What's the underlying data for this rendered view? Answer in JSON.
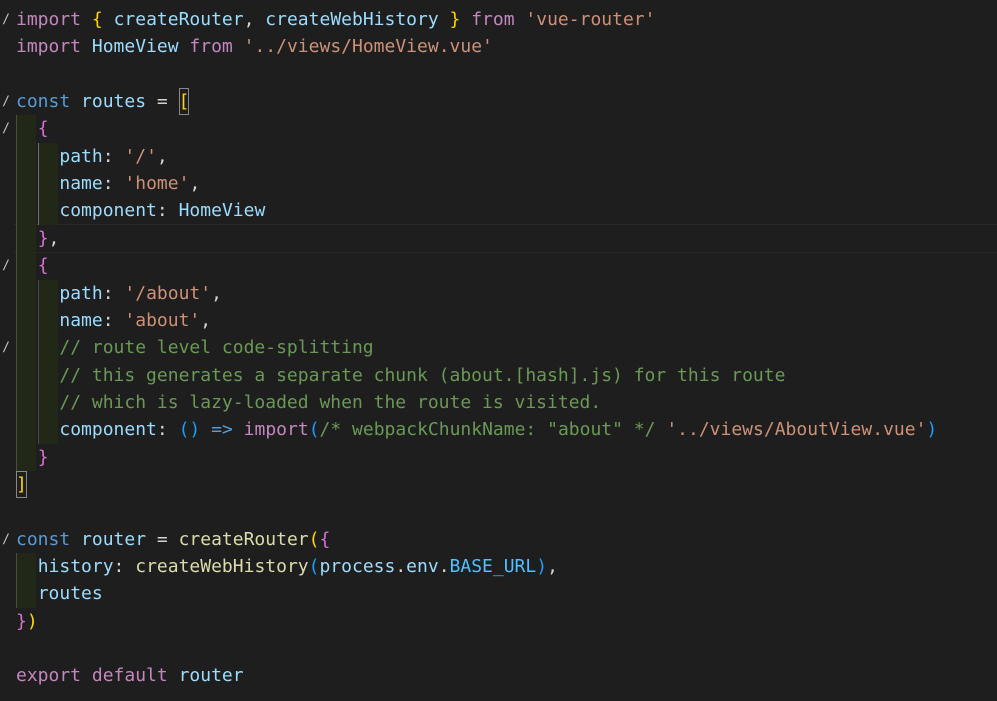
{
  "editor": {
    "language": "javascript",
    "colors": {
      "background": "#1e1e1e",
      "keyword": "#c586c0",
      "declaration": "#569cd6",
      "variable": "#9cdcfe",
      "constant": "#4fc1ff",
      "function": "#dcdcaa",
      "string": "#ce9178",
      "comment": "#6a9955",
      "bracket_level_1": "#ffd700",
      "bracket_level_2": "#da70d6",
      "bracket_level_3": "#179fff"
    },
    "lines": [
      [
        [
          "import",
          "kw"
        ],
        [
          " ",
          "pl"
        ],
        [
          "{",
          "b1"
        ],
        [
          " ",
          "pl"
        ],
        [
          "createRouter",
          "var"
        ],
        [
          ", ",
          "pl"
        ],
        [
          "createWebHistory",
          "var"
        ],
        [
          " ",
          "pl"
        ],
        [
          "}",
          "b1"
        ],
        [
          " ",
          "pl"
        ],
        [
          "from",
          "kw"
        ],
        [
          " ",
          "pl"
        ],
        [
          "'vue-router'",
          "str"
        ]
      ],
      [
        [
          "import",
          "kw"
        ],
        [
          " ",
          "pl"
        ],
        [
          "HomeView",
          "var"
        ],
        [
          " ",
          "pl"
        ],
        [
          "from",
          "kw"
        ],
        [
          " ",
          "pl"
        ],
        [
          "'../views/HomeView.vue'",
          "str"
        ]
      ],
      [],
      [
        [
          "const",
          "dk"
        ],
        [
          " ",
          "pl"
        ],
        [
          "routes",
          "var"
        ],
        [
          " = ",
          "pl"
        ],
        [
          "[",
          "b1"
        ]
      ],
      [
        [
          "  ",
          "pl"
        ],
        [
          "{",
          "b2"
        ]
      ],
      [
        [
          "    ",
          "pl"
        ],
        [
          "path",
          "var"
        ],
        [
          ": ",
          "pl"
        ],
        [
          "'/'",
          "str"
        ],
        [
          ",",
          "pl"
        ]
      ],
      [
        [
          "    ",
          "pl"
        ],
        [
          "name",
          "var"
        ],
        [
          ": ",
          "pl"
        ],
        [
          "'home'",
          "str"
        ],
        [
          ",",
          "pl"
        ]
      ],
      [
        [
          "    ",
          "pl"
        ],
        [
          "component",
          "var"
        ],
        [
          ": ",
          "pl"
        ],
        [
          "HomeView",
          "var"
        ]
      ],
      [
        [
          "  ",
          "pl"
        ],
        [
          "}",
          "b2"
        ],
        [
          ",",
          "pl"
        ]
      ],
      [
        [
          "  ",
          "pl"
        ],
        [
          "{",
          "b2"
        ]
      ],
      [
        [
          "    ",
          "pl"
        ],
        [
          "path",
          "var"
        ],
        [
          ": ",
          "pl"
        ],
        [
          "'/about'",
          "str"
        ],
        [
          ",",
          "pl"
        ]
      ],
      [
        [
          "    ",
          "pl"
        ],
        [
          "name",
          "var"
        ],
        [
          ": ",
          "pl"
        ],
        [
          "'about'",
          "str"
        ],
        [
          ",",
          "pl"
        ]
      ],
      [
        [
          "    ",
          "pl"
        ],
        [
          "// route level code-splitting",
          "cm"
        ]
      ],
      [
        [
          "    ",
          "pl"
        ],
        [
          "// this generates a separate chunk (about.[hash].js) for this route",
          "cm"
        ]
      ],
      [
        [
          "    ",
          "pl"
        ],
        [
          "// which is lazy-loaded when the route is visited.",
          "cm"
        ]
      ],
      [
        [
          "    ",
          "pl"
        ],
        [
          "component",
          "var"
        ],
        [
          ": ",
          "pl"
        ],
        [
          "()",
          "b3"
        ],
        [
          " ",
          "pl"
        ],
        [
          "=>",
          "dk"
        ],
        [
          " ",
          "pl"
        ],
        [
          "import",
          "kw"
        ],
        [
          "(",
          "b3"
        ],
        [
          "/* webpackChunkName: \"about\" */",
          "cm"
        ],
        [
          " ",
          "pl"
        ],
        [
          "'../views/AboutView.vue'",
          "str"
        ],
        [
          ")",
          "b3"
        ]
      ],
      [
        [
          "  ",
          "pl"
        ],
        [
          "}",
          "b2"
        ]
      ],
      [
        [
          "]",
          "b1"
        ]
      ],
      [],
      [
        [
          "const",
          "dk"
        ],
        [
          " ",
          "pl"
        ],
        [
          "router",
          "var"
        ],
        [
          " = ",
          "pl"
        ],
        [
          "createRouter",
          "fn"
        ],
        [
          "(",
          "b1"
        ],
        [
          "{",
          "b2"
        ]
      ],
      [
        [
          "  ",
          "pl"
        ],
        [
          "history",
          "var"
        ],
        [
          ": ",
          "pl"
        ],
        [
          "createWebHistory",
          "fn"
        ],
        [
          "(",
          "b3"
        ],
        [
          "process",
          "var"
        ],
        [
          ".",
          "pl"
        ],
        [
          "env",
          "var"
        ],
        [
          ".",
          "pl"
        ],
        [
          "BASE_URL",
          "const"
        ],
        [
          ")",
          "b3"
        ],
        [
          ",",
          "pl"
        ]
      ],
      [
        [
          "  ",
          "pl"
        ],
        [
          "routes",
          "var"
        ]
      ],
      [
        [
          "}",
          "b2"
        ],
        [
          ")",
          "b1"
        ]
      ],
      [],
      [
        [
          "export",
          "kw"
        ],
        [
          " ",
          "pl"
        ],
        [
          "default",
          "kw"
        ],
        [
          " ",
          "pl"
        ],
        [
          "router",
          "var"
        ]
      ]
    ]
  }
}
